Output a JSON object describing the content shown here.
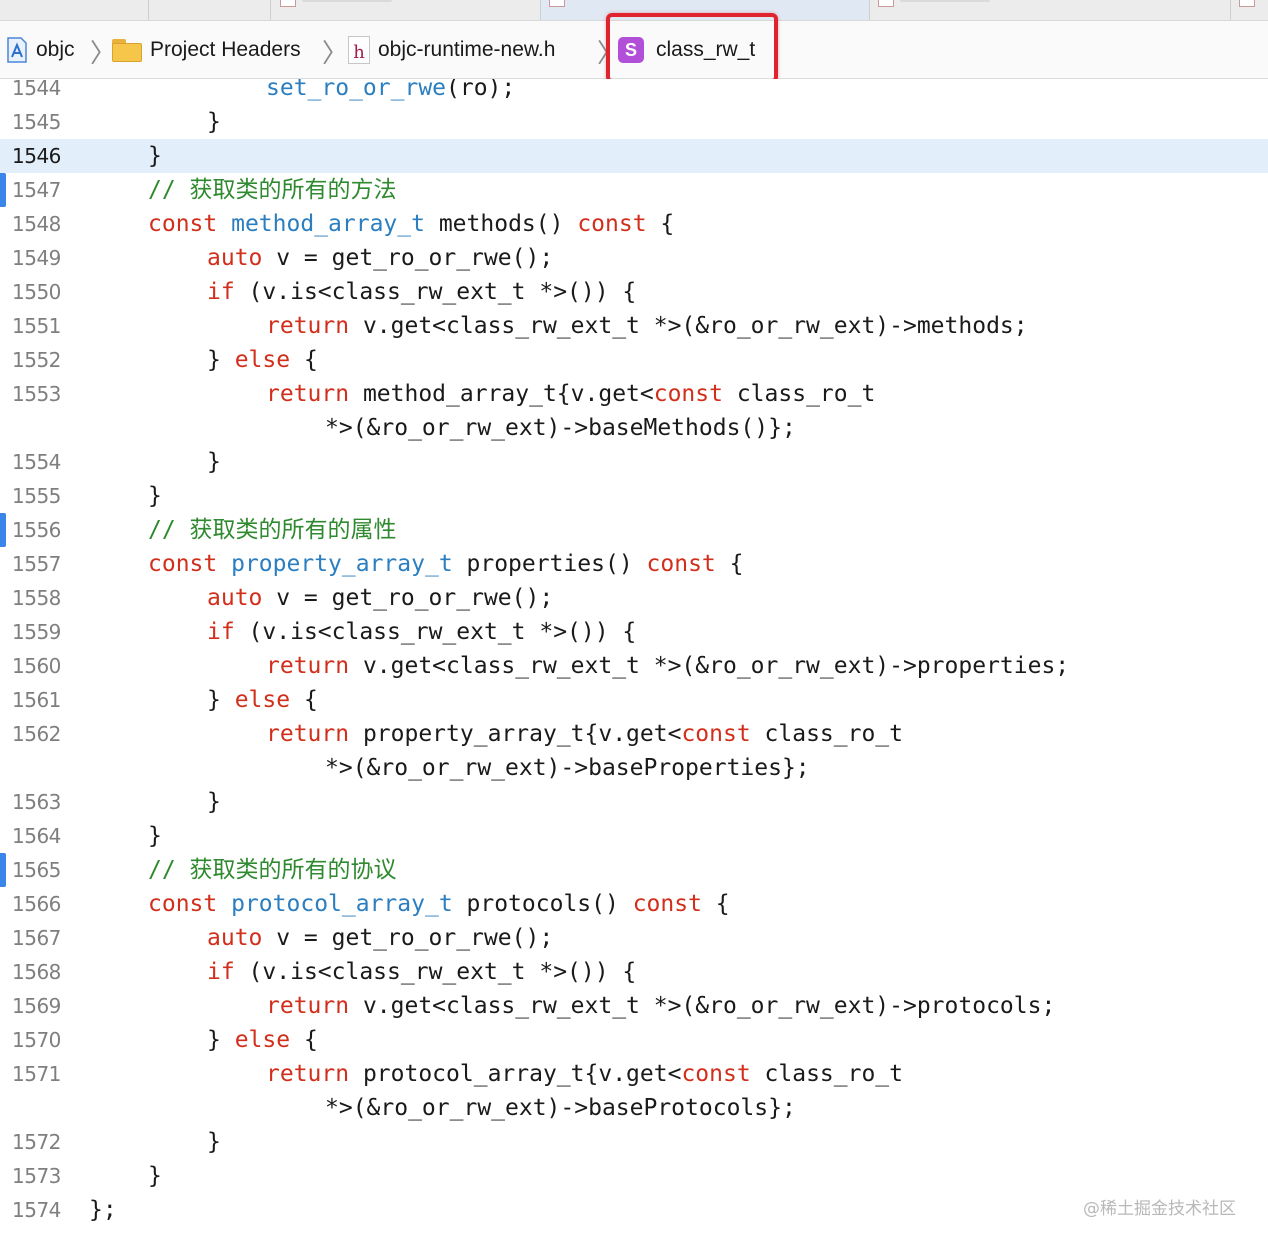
{
  "jumpbar": {
    "crumbs": [
      {
        "label": "objc",
        "icon": "xcode-project-icon"
      },
      {
        "label": "Project Headers",
        "icon": "folder-icon"
      },
      {
        "label": "objc-runtime-new.h",
        "icon": "header-file-icon"
      },
      {
        "label": "class_rw_t",
        "icon": "struct-icon"
      }
    ],
    "header_icon_glyph": "h",
    "struct_icon_glyph": "S",
    "separator": "〉"
  },
  "colors": {
    "keyword": "#d12f1b",
    "type": "#2b7ebf",
    "comment": "#2f8a2f",
    "current_line": "#e2eef9",
    "highlight_box": "#e0242f",
    "change_marker": "#3b84e8"
  },
  "editor": {
    "current_line": "1546",
    "lines": [
      {
        "n": "1544",
        "indent": 3,
        "tokens": [
          [
            "ty",
            "set_ro_or_rwe"
          ],
          [
            "pl",
            "(ro);"
          ]
        ]
      },
      {
        "n": "1545",
        "indent": 2,
        "tokens": [
          [
            "pl",
            "}"
          ]
        ]
      },
      {
        "n": "1546",
        "indent": 1,
        "tokens": [
          [
            "pl",
            "}"
          ]
        ],
        "current": true
      },
      {
        "n": "1547",
        "indent": 1,
        "tokens": [
          [
            "cm",
            "// 获取类的所有的方法"
          ]
        ],
        "marker": true
      },
      {
        "n": "1548",
        "indent": 1,
        "tokens": [
          [
            "kw",
            "const"
          ],
          [
            "pl",
            " "
          ],
          [
            "ty",
            "method_array_t"
          ],
          [
            "pl",
            " methods() "
          ],
          [
            "kw",
            "const"
          ],
          [
            "pl",
            " {"
          ]
        ]
      },
      {
        "n": "1549",
        "indent": 2,
        "tokens": [
          [
            "kw",
            "auto"
          ],
          [
            "pl",
            " v = get_ro_or_rwe();"
          ]
        ]
      },
      {
        "n": "1550",
        "indent": 2,
        "tokens": [
          [
            "kw",
            "if"
          ],
          [
            "pl",
            " (v.is<class_rw_ext_t *>()) {"
          ]
        ]
      },
      {
        "n": "1551",
        "indent": 3,
        "tokens": [
          [
            "kw",
            "return"
          ],
          [
            "pl",
            " v.get<class_rw_ext_t *>(&ro_or_rw_ext)->methods;"
          ]
        ]
      },
      {
        "n": "1552",
        "indent": 2,
        "tokens": [
          [
            "pl",
            "} "
          ],
          [
            "kw",
            "else"
          ],
          [
            "pl",
            " {"
          ]
        ]
      },
      {
        "n": "1553",
        "indent": 3,
        "tokens": [
          [
            "kw",
            "return"
          ],
          [
            "pl",
            " method_array_t{v.get<"
          ],
          [
            "kw",
            "const"
          ],
          [
            "pl",
            " class_ro_t"
          ]
        ]
      },
      {
        "n": "",
        "indent": 4,
        "tokens": [
          [
            "pl",
            "*>(&ro_or_rw_ext)->baseMethods()};"
          ]
        ]
      },
      {
        "n": "1554",
        "indent": 2,
        "tokens": [
          [
            "pl",
            "}"
          ]
        ]
      },
      {
        "n": "1555",
        "indent": 1,
        "tokens": [
          [
            "pl",
            "}"
          ]
        ]
      },
      {
        "n": "1556",
        "indent": 1,
        "tokens": [
          [
            "cm",
            "// 获取类的所有的属性"
          ]
        ],
        "marker": true
      },
      {
        "n": "1557",
        "indent": 1,
        "tokens": [
          [
            "kw",
            "const"
          ],
          [
            "pl",
            " "
          ],
          [
            "ty",
            "property_array_t"
          ],
          [
            "pl",
            " properties() "
          ],
          [
            "kw",
            "const"
          ],
          [
            "pl",
            " {"
          ]
        ]
      },
      {
        "n": "1558",
        "indent": 2,
        "tokens": [
          [
            "kw",
            "auto"
          ],
          [
            "pl",
            " v = get_ro_or_rwe();"
          ]
        ]
      },
      {
        "n": "1559",
        "indent": 2,
        "tokens": [
          [
            "kw",
            "if"
          ],
          [
            "pl",
            " (v.is<class_rw_ext_t *>()) {"
          ]
        ]
      },
      {
        "n": "1560",
        "indent": 3,
        "tokens": [
          [
            "kw",
            "return"
          ],
          [
            "pl",
            " v.get<class_rw_ext_t *>(&ro_or_rw_ext)->properties;"
          ]
        ]
      },
      {
        "n": "1561",
        "indent": 2,
        "tokens": [
          [
            "pl",
            "} "
          ],
          [
            "kw",
            "else"
          ],
          [
            "pl",
            " {"
          ]
        ]
      },
      {
        "n": "1562",
        "indent": 3,
        "tokens": [
          [
            "kw",
            "return"
          ],
          [
            "pl",
            " property_array_t{v.get<"
          ],
          [
            "kw",
            "const"
          ],
          [
            "pl",
            " class_ro_t"
          ]
        ]
      },
      {
        "n": "",
        "indent": 4,
        "tokens": [
          [
            "pl",
            "*>(&ro_or_rw_ext)->baseProperties};"
          ]
        ]
      },
      {
        "n": "1563",
        "indent": 2,
        "tokens": [
          [
            "pl",
            "}"
          ]
        ]
      },
      {
        "n": "1564",
        "indent": 1,
        "tokens": [
          [
            "pl",
            "}"
          ]
        ]
      },
      {
        "n": "1565",
        "indent": 1,
        "tokens": [
          [
            "cm",
            "// 获取类的所有的协议"
          ]
        ],
        "marker": true
      },
      {
        "n": "1566",
        "indent": 1,
        "tokens": [
          [
            "kw",
            "const"
          ],
          [
            "pl",
            " "
          ],
          [
            "ty",
            "protocol_array_t"
          ],
          [
            "pl",
            " protocols() "
          ],
          [
            "kw",
            "const"
          ],
          [
            "pl",
            " {"
          ]
        ]
      },
      {
        "n": "1567",
        "indent": 2,
        "tokens": [
          [
            "kw",
            "auto"
          ],
          [
            "pl",
            " v = get_ro_or_rwe();"
          ]
        ]
      },
      {
        "n": "1568",
        "indent": 2,
        "tokens": [
          [
            "kw",
            "if"
          ],
          [
            "pl",
            " (v.is<class_rw_ext_t *>()) {"
          ]
        ]
      },
      {
        "n": "1569",
        "indent": 3,
        "tokens": [
          [
            "kw",
            "return"
          ],
          [
            "pl",
            " v.get<class_rw_ext_t *>(&ro_or_rw_ext)->protocols;"
          ]
        ]
      },
      {
        "n": "1570",
        "indent": 2,
        "tokens": [
          [
            "pl",
            "} "
          ],
          [
            "kw",
            "else"
          ],
          [
            "pl",
            " {"
          ]
        ]
      },
      {
        "n": "1571",
        "indent": 3,
        "tokens": [
          [
            "kw",
            "return"
          ],
          [
            "pl",
            " protocol_array_t{v.get<"
          ],
          [
            "kw",
            "const"
          ],
          [
            "pl",
            " class_ro_t"
          ]
        ]
      },
      {
        "n": "",
        "indent": 4,
        "tokens": [
          [
            "pl",
            "*>(&ro_or_rw_ext)->baseProtocols};"
          ]
        ]
      },
      {
        "n": "1572",
        "indent": 2,
        "tokens": [
          [
            "pl",
            "}"
          ]
        ]
      },
      {
        "n": "1573",
        "indent": 1,
        "tokens": [
          [
            "pl",
            "}"
          ]
        ]
      },
      {
        "n": "1574",
        "indent": 0,
        "tokens": [
          [
            "pl",
            "};"
          ]
        ]
      }
    ]
  },
  "watermark": "@稀土掘金技术社区"
}
